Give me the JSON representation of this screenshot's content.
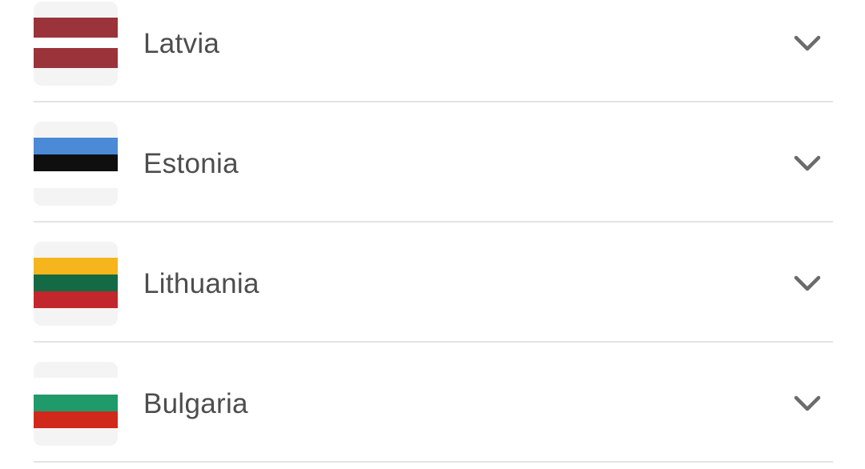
{
  "countries": [
    {
      "name": "Latvia",
      "icon": "latvia-flag-icon",
      "stripes": [
        {
          "color": "#9a333a",
          "ratio": 2
        },
        {
          "color": "#ffffff",
          "ratio": 1
        },
        {
          "color": "#9a333a",
          "ratio": 2
        }
      ]
    },
    {
      "name": "Estonia",
      "icon": "estonia-flag-icon",
      "stripes": [
        {
          "color": "#4a8ad6",
          "ratio": 1
        },
        {
          "color": "#0f0f0f",
          "ratio": 1
        },
        {
          "color": "#ffffff",
          "ratio": 1
        }
      ]
    },
    {
      "name": "Lithuania",
      "icon": "lithuania-flag-icon",
      "stripes": [
        {
          "color": "#f6b51c",
          "ratio": 1
        },
        {
          "color": "#136a44",
          "ratio": 1
        },
        {
          "color": "#c1272d",
          "ratio": 1
        }
      ]
    },
    {
      "name": "Bulgaria",
      "icon": "bulgaria-flag-icon",
      "stripes": [
        {
          "color": "#ffffff",
          "ratio": 1
        },
        {
          "color": "#1f9a6b",
          "ratio": 1
        },
        {
          "color": "#d0291b",
          "ratio": 1
        }
      ]
    }
  ],
  "chevron_icon": "chevron-down-icon",
  "colors": {
    "text": "#4d4d4d",
    "divider": "#e3e3e3",
    "chevron": "#6b6b6b",
    "tile_bg": "#f4f4f4"
  }
}
